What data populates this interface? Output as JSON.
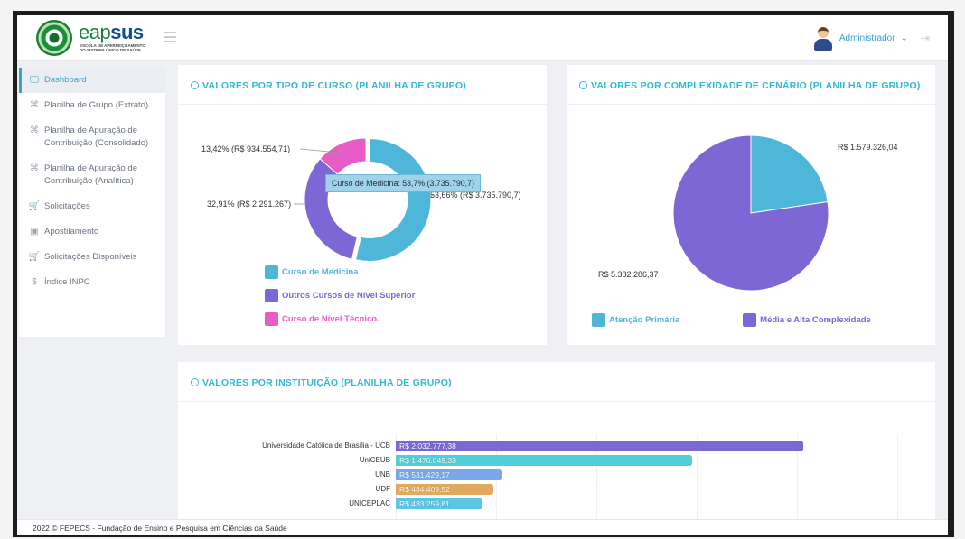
{
  "header": {
    "logo_main": "eap",
    "logo_bold": "sus",
    "logo_sub": "ESCOLA DE APERFEIÇOAMENTO DO SISTEMA ÚNICO DE SAÚDE",
    "user_name": "Administrador",
    "user_caret": "⌄",
    "logout_icon": "⇥"
  },
  "sidebar": {
    "items": [
      {
        "label": "Dashboard",
        "icon": "🖵"
      },
      {
        "label": "Planilha de Grupo (Extrato)",
        "icon": "⌘"
      },
      {
        "label": "Planilha de Apuração de Contribuição (Consolidado)",
        "icon": "⌘"
      },
      {
        "label": "Planilha de Apuração de Contribuição (Analítica)",
        "icon": "⌘"
      },
      {
        "label": "Solicitações",
        "icon": "🛒"
      },
      {
        "label": "Apostilamento",
        "icon": "▣"
      },
      {
        "label": "Solicitações Disponíveis",
        "icon": "🛒"
      },
      {
        "label": "Índice INPC",
        "icon": "$"
      }
    ]
  },
  "card_course": {
    "title": "VALORES POR TIPO DE CURSO (PLANILHA DE GRUPO)",
    "tooltip": "Curso de Medicina: 53,7% (3.735.790,7)",
    "labels": {
      "tecnico": "13,42% (R$ 934.554,71)",
      "outros": "32,91% (R$ 2.291.267)",
      "medicina": "53,66% (R$ 3.735.790,7)"
    },
    "legend": [
      {
        "label": "Curso de Medicina",
        "color": "#4db6d9"
      },
      {
        "label": "Outros Cursos de Nível Superior",
        "color": "#7d67d4"
      },
      {
        "label": "Curso de Nível Técnico.",
        "color": "#e85cc6"
      }
    ]
  },
  "card_complexity": {
    "title": "VALORES POR COMPLEXIDADE DE CENÁRIO (PLANILHA DE GRUPO)",
    "labels": {
      "primaria": "R$ 1.579.326,04",
      "media": "R$ 5.382.286,37"
    },
    "legend": [
      {
        "label": "Atenção Primária",
        "color": "#4db6d9"
      },
      {
        "label": "Média e Alta Complexidade",
        "color": "#7d67d4"
      }
    ]
  },
  "card_institution": {
    "title": "VALORES POR INSTITUIÇÃO (PLANILHA DE GRUPO)"
  },
  "chart_data": [
    {
      "type": "pie",
      "categories": [
        "Curso de Medicina",
        "Outros Cursos de Nível Superior",
        "Curso de Nível Técnico."
      ],
      "values": [
        3735790.7,
        2291267,
        934554.71
      ],
      "percentages": [
        53.66,
        32.91,
        13.42
      ],
      "title": "VALORES POR TIPO DE CURSO (PLANILHA DE GRUPO)",
      "legend": "bottom-left"
    },
    {
      "type": "pie",
      "categories": [
        "Atenção Primária",
        "Média e Alta Complexidade"
      ],
      "values": [
        1579326.04,
        5382286.37
      ],
      "title": "VALORES POR COMPLEXIDADE DE CENÁRIO (PLANILHA DE GRUPO)",
      "legend": "bottom"
    },
    {
      "type": "bar",
      "orientation": "horizontal",
      "title": "VALORES POR INSTITUIÇÃO (PLANILHA DE GRUPO)",
      "categories": [
        "Universidade Católica de Brasília - UCB",
        "UniCEUB",
        "UNB",
        "UDF",
        "UNICEPLAC"
      ],
      "values": [
        2032777.38,
        1476049.33,
        531429.17,
        484409.52,
        433259.81
      ],
      "value_labels": [
        "R$ 2.032.777,38",
        "R$ 1.476.049,33",
        "R$ 531.429,17",
        "R$ 484.409,52",
        "R$ 433.259,81"
      ],
      "colors": [
        "#7d67d4",
        "#4fd0d8",
        "#7aa6ec",
        "#e0a95e",
        "#5cc6e4"
      ],
      "xlim": [
        0,
        2500000
      ]
    }
  ],
  "footer": {
    "text": "2022 © FEPECS - Fundação de Ensino e Pesquisa em Ciências da Saúde"
  }
}
